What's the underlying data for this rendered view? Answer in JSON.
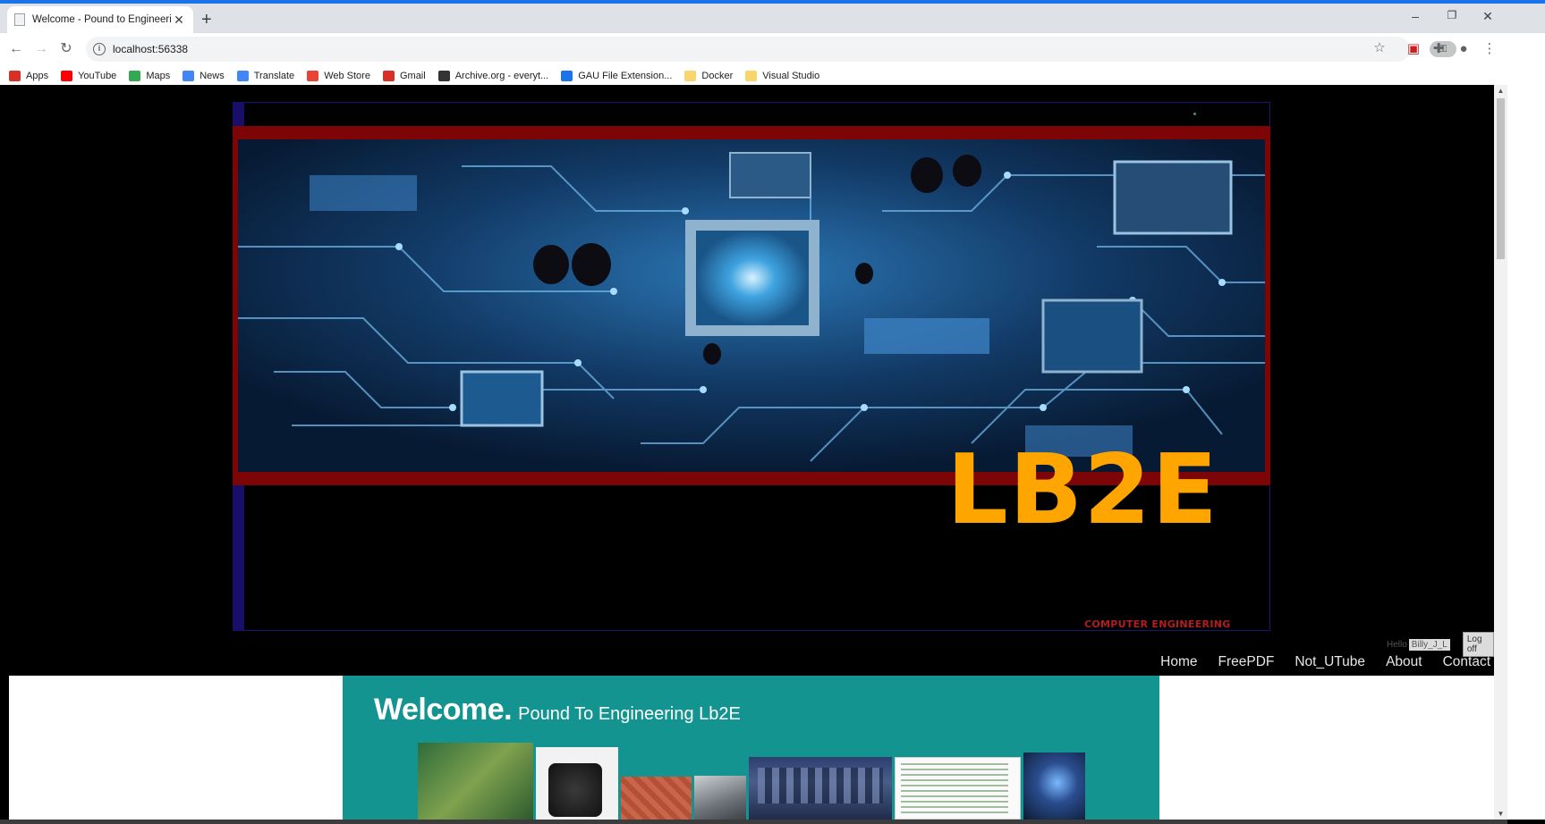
{
  "browser": {
    "tab_title": "Welcome - Pound to Engineering",
    "url": "localhost:56338",
    "new_tab_symbol": "+",
    "bookmarks": [
      {
        "label": "Apps",
        "icon": "apps-grid-icon",
        "color": "#d93025"
      },
      {
        "label": "YouTube",
        "icon": "youtube-icon",
        "color": "#ff0000"
      },
      {
        "label": "Maps",
        "icon": "maps-icon",
        "color": "#34a853"
      },
      {
        "label": "News",
        "icon": "news-icon",
        "color": "#4285f4"
      },
      {
        "label": "Translate",
        "icon": "translate-icon",
        "color": "#4285f4"
      },
      {
        "label": "Web Store",
        "icon": "web-store-icon",
        "color": "#ea4335"
      },
      {
        "label": "Gmail",
        "icon": "gmail-icon",
        "color": "#d93025"
      },
      {
        "label": "Archive.org - everyt...",
        "icon": "archive-icon",
        "color": "#333333"
      },
      {
        "label": "GAU File Extension...",
        "icon": "gau-icon",
        "color": "#1a73e8"
      },
      {
        "label": "Docker",
        "icon": "folder-icon",
        "color": "#f9d56e"
      },
      {
        "label": "Visual Studio",
        "icon": "folder-icon",
        "color": "#f9d56e"
      }
    ]
  },
  "site": {
    "logo": "LB2E",
    "tagline": "COMPUTER ENGINEERING",
    "greeting": "Hello",
    "user": "Billy_J_L",
    "logoff": "Log off",
    "nav": [
      "Home",
      "FreePDF",
      "Not_UTube",
      "About",
      "Contact"
    ],
    "welcome_title": "Welcome.",
    "welcome_subtitle": "Pound To Engineering Lb2E"
  },
  "colors": {
    "banner_red": "#7e0505",
    "logo_orange": "#ffa500",
    "welcome_teal": "#149490",
    "sidebar_navy": "#190e69"
  }
}
